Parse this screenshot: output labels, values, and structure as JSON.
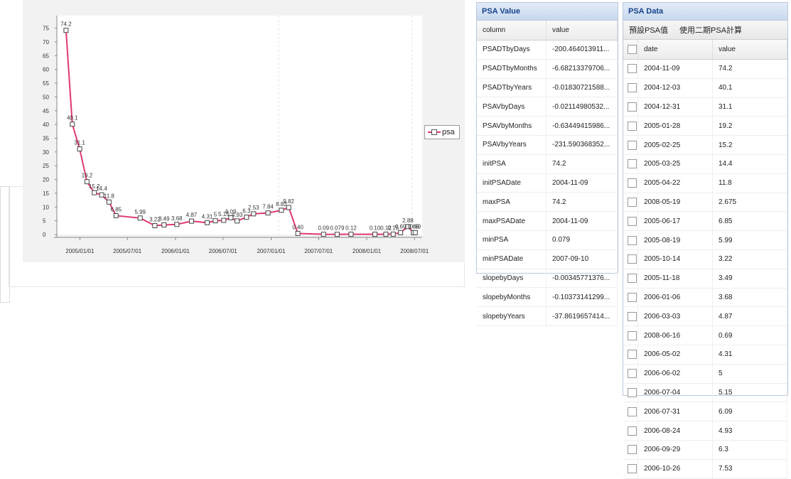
{
  "chart_data": {
    "type": "line",
    "xticks": [
      "2005/01/01",
      "2005/07/01",
      "2006/01/01",
      "2006/07/01",
      "2007/01/01",
      "2007/07/01",
      "2008/01/01",
      "2008/07/01"
    ],
    "yticks": [
      "0",
      "5",
      "10",
      "15",
      "20",
      "25",
      "30",
      "35",
      "40",
      "45",
      "50",
      "55",
      "60",
      "65",
      "70",
      "75"
    ],
    "ylim": [
      0,
      78
    ],
    "series": [
      {
        "name": "psa",
        "color": "#e0386e",
        "points": [
          {
            "x": "2004-11-09",
            "y": 74.2,
            "label": "74.2"
          },
          {
            "x": "2004-12-03",
            "y": 40.1,
            "label": "40.1"
          },
          {
            "x": "2004-12-31",
            "y": 31.1,
            "label": "31.1"
          },
          {
            "x": "2005-01-28",
            "y": 19.2,
            "label": "19.2"
          },
          {
            "x": "2005-02-25",
            "y": 15.2,
            "label": "15.2"
          },
          {
            "x": "2005-03-25",
            "y": 14.4,
            "label": "14.4"
          },
          {
            "x": "2005-04-22",
            "y": 11.8,
            "label": "11.8"
          },
          {
            "x": "2005-05-19",
            "y": 6.85,
            "label": "6.85"
          },
          {
            "x": "2005-08-19",
            "y": 5.99,
            "label": "5.99"
          },
          {
            "x": "2005-10-14",
            "y": 3.22,
            "label": "3.22"
          },
          {
            "x": "2005-11-18",
            "y": 3.49,
            "label": "3.49"
          },
          {
            "x": "2006-01-06",
            "y": 3.68,
            "label": "3.68"
          },
          {
            "x": "2006-03-03",
            "y": 4.87,
            "label": "4.87"
          },
          {
            "x": "2006-05-02",
            "y": 4.31,
            "label": "4.31"
          },
          {
            "x": "2006-06-02",
            "y": 5,
            "label": "5"
          },
          {
            "x": "2006-07-04",
            "y": 5.15,
            "label": "5.15"
          },
          {
            "x": "2006-07-31",
            "y": 6.09,
            "label": "6.09"
          },
          {
            "x": "2006-08-24",
            "y": 4.93,
            "label": "4.93"
          },
          {
            "x": "2006-09-29",
            "y": 6.3,
            "label": "6.3"
          },
          {
            "x": "2006-10-26",
            "y": 7.53,
            "label": "7.53"
          },
          {
            "x": "2006-12-20",
            "y": 7.84,
            "label": "7.84"
          },
          {
            "x": "2007-02-09",
            "y": 8.82,
            "label": "8.82"
          },
          {
            "x": "2007-03-09",
            "y": 9.82,
            "label": "9.82"
          },
          {
            "x": "2007-04-13",
            "y": 0.4,
            "label": "0.40"
          },
          {
            "x": "2007-07-20",
            "y": 0.09,
            "label": "0.09"
          },
          {
            "x": "2007-09-10",
            "y": 0.079,
            "label": "0.079"
          },
          {
            "x": "2007-11-02",
            "y": 0.12,
            "label": "0.12"
          },
          {
            "x": "2008-02-01",
            "y": 0.1,
            "label": "0.10"
          },
          {
            "x": "2008-03-14",
            "y": 0.12,
            "label": "0.12"
          },
          {
            "x": "2008-04-11",
            "y": 0.15,
            "label": "0.15"
          },
          {
            "x": "2008-05-09",
            "y": 0.69,
            "label": "0.69"
          },
          {
            "x": "2008-06-06",
            "y": 2.88,
            "label": "2.88"
          },
          {
            "x": "2008-06-27",
            "y": 0.68,
            "label": "0.68"
          },
          {
            "x": "2008-07-04",
            "y": 0.69,
            "label": "0.69"
          }
        ]
      }
    ],
    "legend": "right"
  },
  "psa_value_panel": {
    "title": "PSA Value",
    "headers": [
      "column",
      "value"
    ],
    "rows": [
      [
        "PSADTbyDays",
        "-200.464013911..."
      ],
      [
        "PSADTbyMonths",
        "-6.68213379706..."
      ],
      [
        "PSADTbyYears",
        "-0.01830721588..."
      ],
      [
        "PSAVbyDays",
        "-0.02114980532..."
      ],
      [
        "PSAVbyMonths",
        "-0.63449415986..."
      ],
      [
        "PSAVbyYears",
        "-231.590368352..."
      ],
      [
        "initPSA",
        "74.2"
      ],
      [
        "initPSADate",
        "2004-11-09"
      ],
      [
        "maxPSA",
        "74.2"
      ],
      [
        "maxPSADate",
        "2004-11-09"
      ],
      [
        "minPSA",
        "0.079"
      ],
      [
        "minPSADate",
        "2007-09-10"
      ],
      [
        "slopebyDays",
        "-0.00345771376..."
      ],
      [
        "slopebyMonths",
        "-0.10373141299..."
      ],
      [
        "slopebyYears",
        "-37.8619657414..."
      ]
    ]
  },
  "psa_data_panel": {
    "title": "PSA Data",
    "toolbar": [
      "預設PSA值",
      "使用二期PSA計算"
    ],
    "headers": [
      "date",
      "value"
    ],
    "rows": [
      [
        "2004-11-09",
        "74.2"
      ],
      [
        "2004-12-03",
        "40.1"
      ],
      [
        "2004-12-31",
        "31.1"
      ],
      [
        "2005-01-28",
        "19.2"
      ],
      [
        "2005-02-25",
        "15.2"
      ],
      [
        "2005-03-25",
        "14.4"
      ],
      [
        "2005-04-22",
        "11.8"
      ],
      [
        "2008-05-19",
        "2.675"
      ],
      [
        "2005-06-17",
        "6.85"
      ],
      [
        "2005-08-19",
        "5.99"
      ],
      [
        "2005-10-14",
        "3.22"
      ],
      [
        "2005-11-18",
        "3.49"
      ],
      [
        "2006-01-06",
        "3.68"
      ],
      [
        "2006-03-03",
        "4.87"
      ],
      [
        "2008-06-16",
        "0.69"
      ],
      [
        "2006-05-02",
        "4.31"
      ],
      [
        "2006-06-02",
        "5"
      ],
      [
        "2006-07-04",
        "5.15"
      ],
      [
        "2006-07-31",
        "6.09"
      ],
      [
        "2006-08-24",
        "4.93"
      ],
      [
        "2006-09-29",
        "6.3"
      ],
      [
        "2006-10-26",
        "7.53"
      ]
    ]
  }
}
